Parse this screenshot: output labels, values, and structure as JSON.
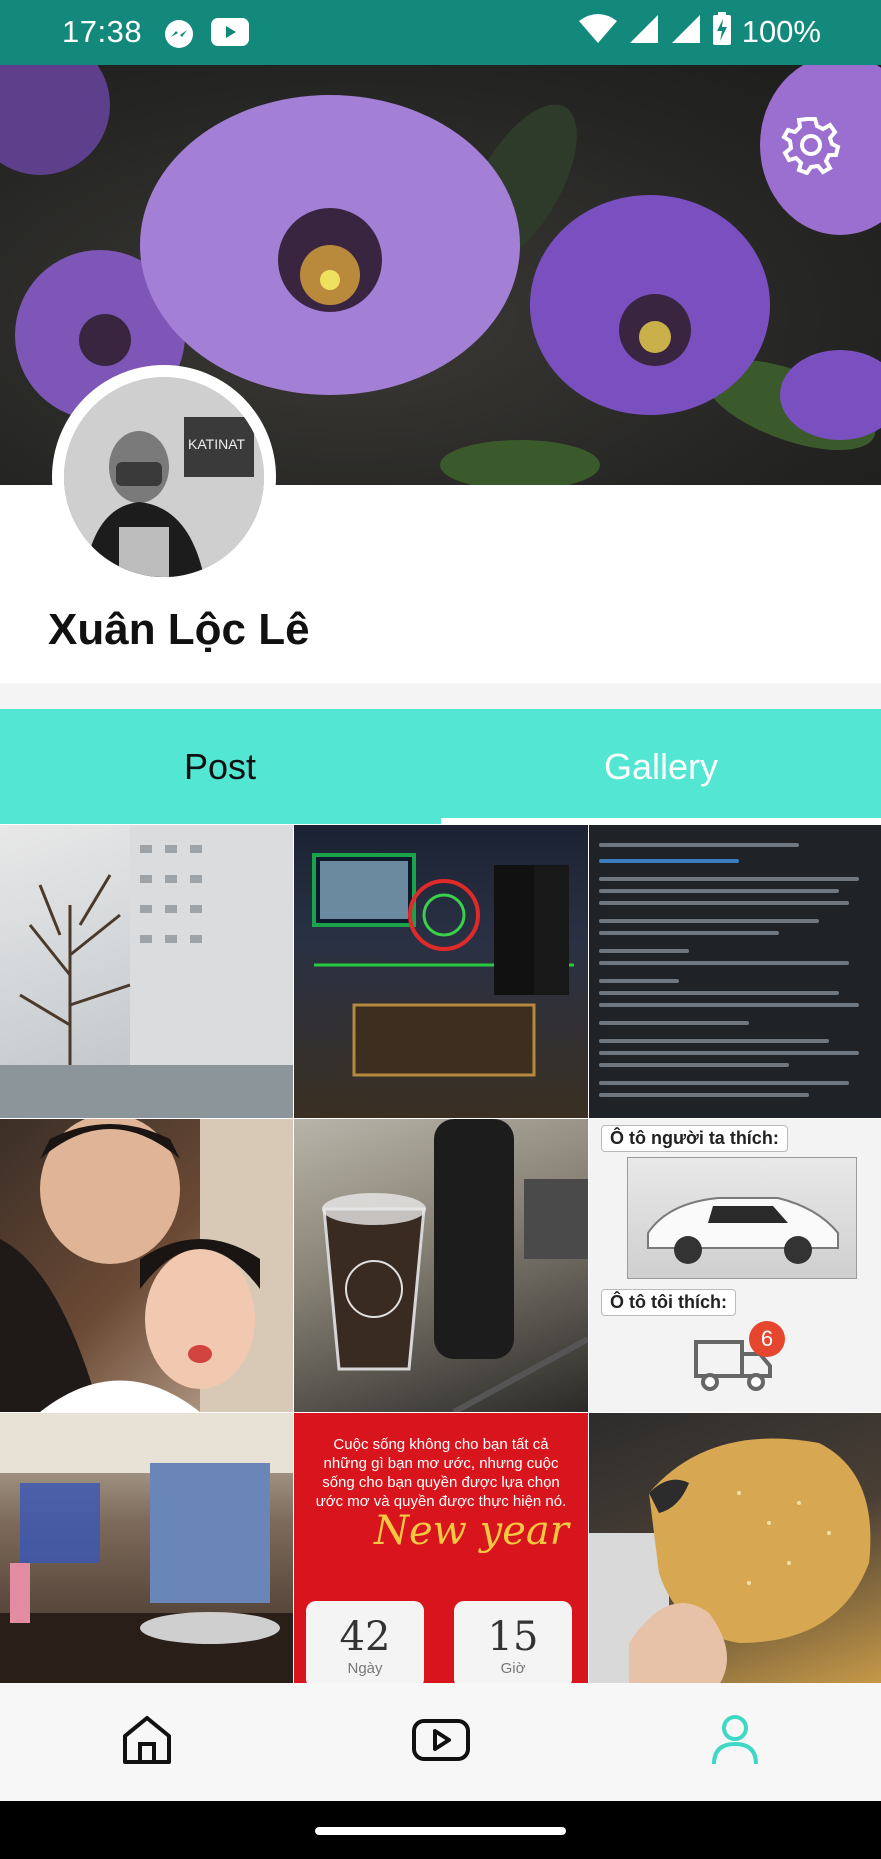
{
  "status_bar": {
    "time": "17:38",
    "battery": "100%",
    "icons": [
      "messenger-icon",
      "youtube-icon",
      "wifi-icon",
      "signal-icon",
      "signal-icon",
      "battery-charging-icon"
    ]
  },
  "profile": {
    "name": "Xuân Lộc Lê",
    "settings_icon": "gear-icon"
  },
  "tabs": [
    {
      "label": "Post",
      "selected": false
    },
    {
      "label": "Gallery",
      "selected": true
    }
  ],
  "gallery": {
    "tile_texts": {
      "car_caption_top": "Ô tô người ta thích:",
      "car_caption_bottom": "Ô tô tôi thích:",
      "truck_badge": "6",
      "newyear_quote": "Cuộc sống không cho bạn tất cả những gì bạn mơ ước, nhưng cuộc sống cho bạn quyền được lựa chọn ước mơ và quyền được thực hiện nó.",
      "newyear_title": "New year",
      "countdown_days": "42",
      "countdown_days_unit": "Ngày",
      "countdown_hours": "15",
      "countdown_hours_unit": "Giờ"
    }
  },
  "bottom_nav": [
    {
      "icon": "home-icon",
      "active": false
    },
    {
      "icon": "video-play-icon",
      "active": false
    },
    {
      "icon": "profile-icon",
      "active": true
    }
  ],
  "colors": {
    "status_bar": "#13897c",
    "tab_bar": "#52e6d3",
    "accent": "#3fd8c4"
  }
}
